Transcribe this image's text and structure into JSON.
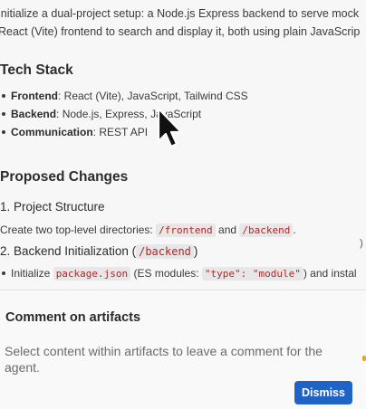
{
  "document": {
    "intro_line1": "initialize a dual-project setup: a Node.js Express backend to serve mock",
    "intro_line2": "React (Vite) frontend to search and display it, both using plain JavaScrip",
    "tech_stack_heading": "Tech Stack",
    "tech_stack": [
      {
        "label": "Frontend",
        "value": ": React (Vite), JavaScript, Tailwind CSS"
      },
      {
        "label": "Backend",
        "value": ": Node.js, Express, JavaScript"
      },
      {
        "label": "Communication",
        "value": ": REST API"
      }
    ],
    "proposed_heading": "Proposed Changes",
    "section1_heading": "1. Project Structure",
    "section1_text_before": "Create two top-level directories: ",
    "section1_code1": "/frontend",
    "section1_text_and": " and ",
    "section1_code2": "/backend",
    "section1_text_after": ".",
    "section2_heading_before": "2. Backend Initialization (",
    "section2_heading_code": "/backend",
    "section2_heading_after": ")",
    "section2_item_before": "Initialize ",
    "section2_item_code1": "package.json",
    "section2_item_mid": " (ES modules: ",
    "section2_item_code2": "\"type\": \"module\"",
    "section2_item_after": ") and instal"
  },
  "comment_panel": {
    "title": "Comment on artifacts",
    "body": "Select content within artifacts to leave a comment for the agent.",
    "dismiss_label": "Dismiss"
  },
  "colors": {
    "accent": "#1f63c7",
    "code_text": "#b3261e",
    "code_bg": "#e7e7ea"
  },
  "icons": [
    "mouse-pointer-icon"
  ]
}
